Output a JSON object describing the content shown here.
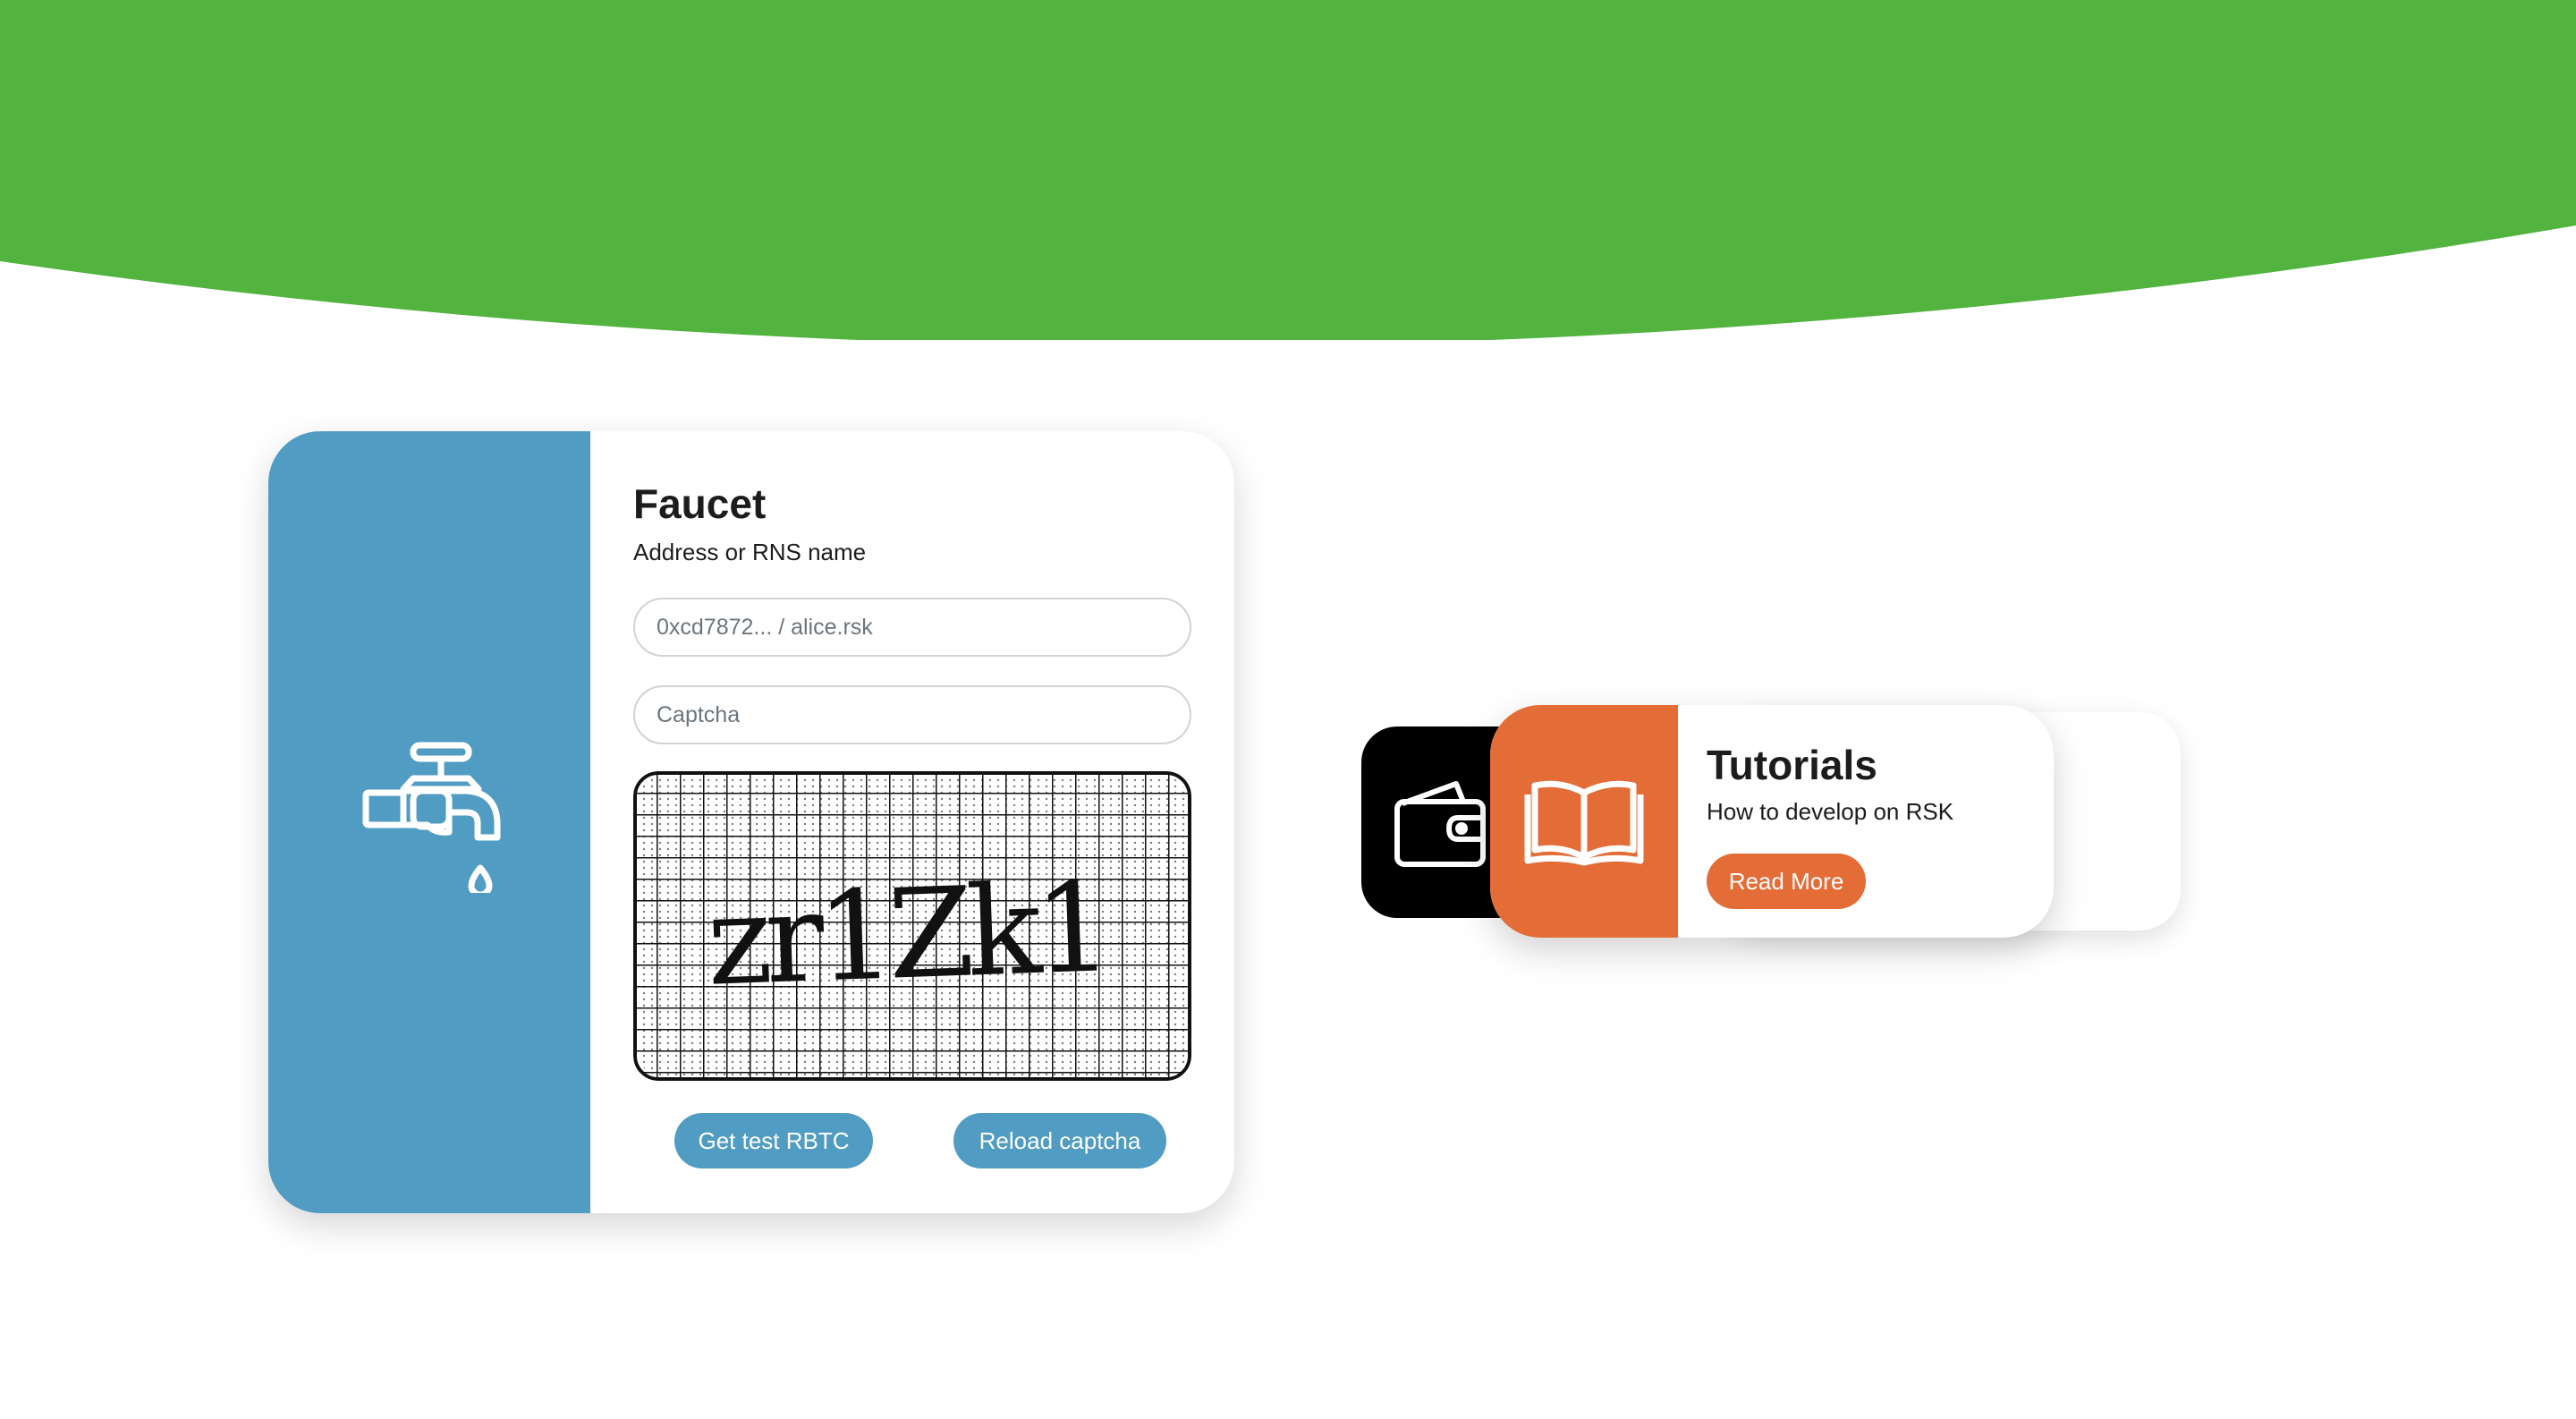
{
  "colors": {
    "top_strip": "#b53a2e",
    "header_green": "#52b43f",
    "faucet_blue": "#519cc2",
    "tutorial_orange": "#e46c37",
    "wallet_black": "#000000",
    "button_blue": "#519cc2",
    "button_orange": "#e46c37"
  },
  "faucet": {
    "icon": "water-tap-icon",
    "title": "Faucet",
    "address_label": "Address or RNS name",
    "address_placeholder": "0xcd7872... / alice.rsk",
    "address_value": "",
    "captcha_placeholder": "Captcha",
    "captcha_value": "",
    "captcha_text": "zr1Zk1",
    "get_button": "Get test RBTC",
    "reload_button": "Reload captcha"
  },
  "cards": {
    "wallet": {
      "icon": "wallet-icon"
    },
    "tutorials": {
      "icon": "open-book-icon",
      "title": "Tutorials",
      "subtitle": "How to develop on RSK",
      "button": "Read More"
    }
  }
}
